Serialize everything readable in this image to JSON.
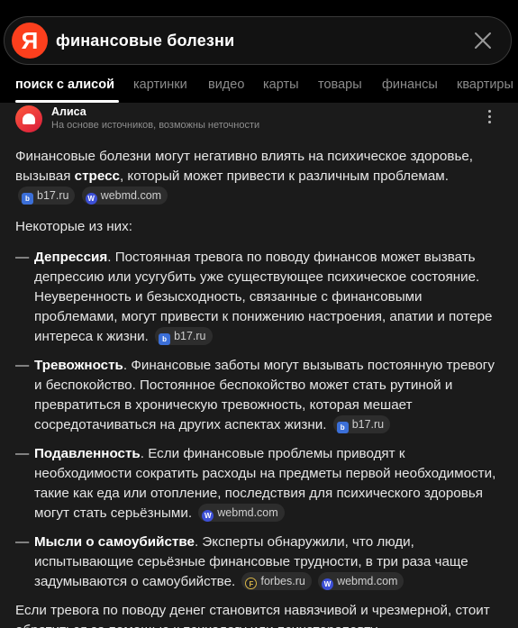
{
  "search": {
    "logo_letter": "Я",
    "query": "финансовые болезни"
  },
  "tabs": [
    {
      "label": "поиск с алисой",
      "active": true
    },
    {
      "label": "картинки"
    },
    {
      "label": "видео"
    },
    {
      "label": "карты"
    },
    {
      "label": "товары"
    },
    {
      "label": "финансы"
    },
    {
      "label": "квартиры"
    }
  ],
  "alice": {
    "name": "Алиса",
    "note": "На основе источников, возможны неточности"
  },
  "answer": {
    "intro_before": "Финансовые болезни могут негативно влиять на психическое здоровье, вызывая ",
    "intro_bold": "стресс",
    "intro_after": ", который может привести к различным проблемам.",
    "intro_sources": [
      "b17.ru",
      "webmd.com"
    ],
    "list_heading": "Некоторые из них:",
    "items": [
      {
        "title": "Депрессия",
        "text": ". Постоянная тревога по поводу финансов может вызвать депрессию или усугубить уже существующее психическое состояние. Неуверенность и безысходность, связанные с финансовыми проблемами, могут привести к понижению настроения, апатии и потере интереса к жизни.",
        "sources": [
          "b17.ru"
        ]
      },
      {
        "title": "Тревожность",
        "text": ". Финансовые заботы могут вызывать постоянную тревогу и беспокойство. Постоянное беспокойство может стать рутиной и превратиться в хроническую тревожность, которая мешает сосредотачиваться на других аспектах жизни.",
        "sources": [
          "b17.ru"
        ]
      },
      {
        "title": "Подавленность",
        "text": ". Если финансовые проблемы приводят к необходимости сократить расходы на предметы первой необходимости, такие как еда или отопление, последствия для психического здоровья могут стать серьёзными.",
        "sources": [
          "webmd.com"
        ]
      },
      {
        "title": "Мысли о самоубийстве",
        "text": ". Эксперты обнаружили, что люди, испытывающие серьёзные финансовые трудности, в три раза чаще задумываются о самоубийстве.",
        "sources": [
          "forbes.ru",
          "webmd.com"
        ]
      }
    ],
    "outro": "Если тревога по поводу денег становится навязчивой и чрезмерной, стоит обратиться за помощью к психологу или психотерапевту."
  },
  "colors": {
    "yandex_red": "#fc3f1d",
    "background": "#000000",
    "card": "#1b1b1b"
  }
}
